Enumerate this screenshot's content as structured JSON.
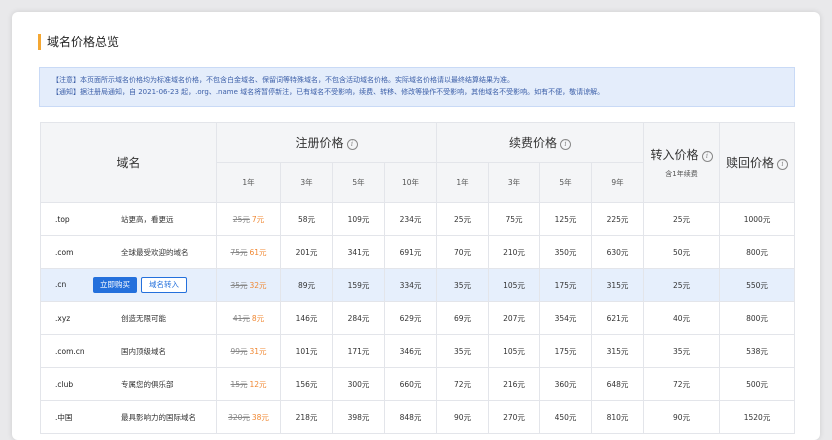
{
  "page_title": "域名价格总览",
  "notice": {
    "line1": "【注意】本页面所示域名价格均为标准域名价格，不包含白金域名、保留词等特殊域名，不包含活动域名价格。实际域名价格请以最终结算结果为准。",
    "line2": "【通知】据注册局通知，自 2021-06-23 起，.org、.name 域名将暂停新注，已有域名不受影响，续费、转移、修改等操作不受影响，其他域名不受影响。如有不便，敬请谅解。"
  },
  "table": {
    "header": {
      "name": "域名",
      "register": "注册价格",
      "renew": "续费价格",
      "transfer": "转入价格",
      "transfer_note": "含1年续费",
      "redeem": "赎回价格",
      "register_years": [
        "1年",
        "3年",
        "5年",
        "10年"
      ],
      "renew_years": [
        "1年",
        "3年",
        "5年",
        "9年"
      ]
    },
    "actions": {
      "buy": "立即购买",
      "transfer": "域名转入"
    },
    "rows": [
      {
        "tld": ".top",
        "desc": "站更高，看更远",
        "old": "25元",
        "new": "7元",
        "reg3": "58元",
        "reg5": "109元",
        "reg10": "234元",
        "ren1": "25元",
        "ren3": "75元",
        "ren5": "125元",
        "ren9": "225元",
        "transfer": "25元",
        "redeem": "1000元"
      },
      {
        "tld": ".com",
        "desc": "全球最受欢迎的域名",
        "old": "75元",
        "new": "61元",
        "reg3": "201元",
        "reg5": "341元",
        "reg10": "691元",
        "ren1": "70元",
        "ren3": "210元",
        "ren5": "350元",
        "ren9": "630元",
        "transfer": "50元",
        "redeem": "800元"
      },
      {
        "tld": ".cn",
        "desc": "",
        "old": "35元",
        "new": "32元",
        "reg3": "89元",
        "reg5": "159元",
        "reg10": "334元",
        "ren1": "35元",
        "ren3": "105元",
        "ren5": "175元",
        "ren9": "315元",
        "transfer": "25元",
        "redeem": "550元"
      },
      {
        "tld": ".xyz",
        "desc": "创造无限可能",
        "old": "41元",
        "new": "8元",
        "reg3": "146元",
        "reg5": "284元",
        "reg10": "629元",
        "ren1": "69元",
        "ren3": "207元",
        "ren5": "354元",
        "ren9": "621元",
        "transfer": "40元",
        "redeem": "800元"
      },
      {
        "tld": ".com.cn",
        "desc": "国内顶级域名",
        "old": "99元",
        "new": "31元",
        "reg3": "101元",
        "reg5": "171元",
        "reg10": "346元",
        "ren1": "35元",
        "ren3": "105元",
        "ren5": "175元",
        "ren9": "315元",
        "transfer": "35元",
        "redeem": "538元"
      },
      {
        "tld": ".club",
        "desc": "专属您的俱乐部",
        "old": "15元",
        "new": "12元",
        "reg3": "156元",
        "reg5": "300元",
        "reg10": "660元",
        "ren1": "72元",
        "ren3": "216元",
        "ren5": "360元",
        "ren9": "648元",
        "transfer": "72元",
        "redeem": "500元"
      },
      {
        "tld": ".中国",
        "desc": "最具影响力的国际域名",
        "old": "320元",
        "new": "38元",
        "reg3": "218元",
        "reg5": "398元",
        "reg10": "848元",
        "ren1": "90元",
        "ren3": "270元",
        "ren5": "450元",
        "ren9": "810元",
        "transfer": "90元",
        "redeem": "1520元"
      }
    ]
  },
  "colors": {
    "accent_bar": "#f4a733",
    "discount": "#f08833",
    "primary": "#2470dc",
    "notice_bg": "#e4edfb",
    "highlight_row": "#e6effc"
  },
  "icons": {
    "info": "info-circle-icon"
  }
}
